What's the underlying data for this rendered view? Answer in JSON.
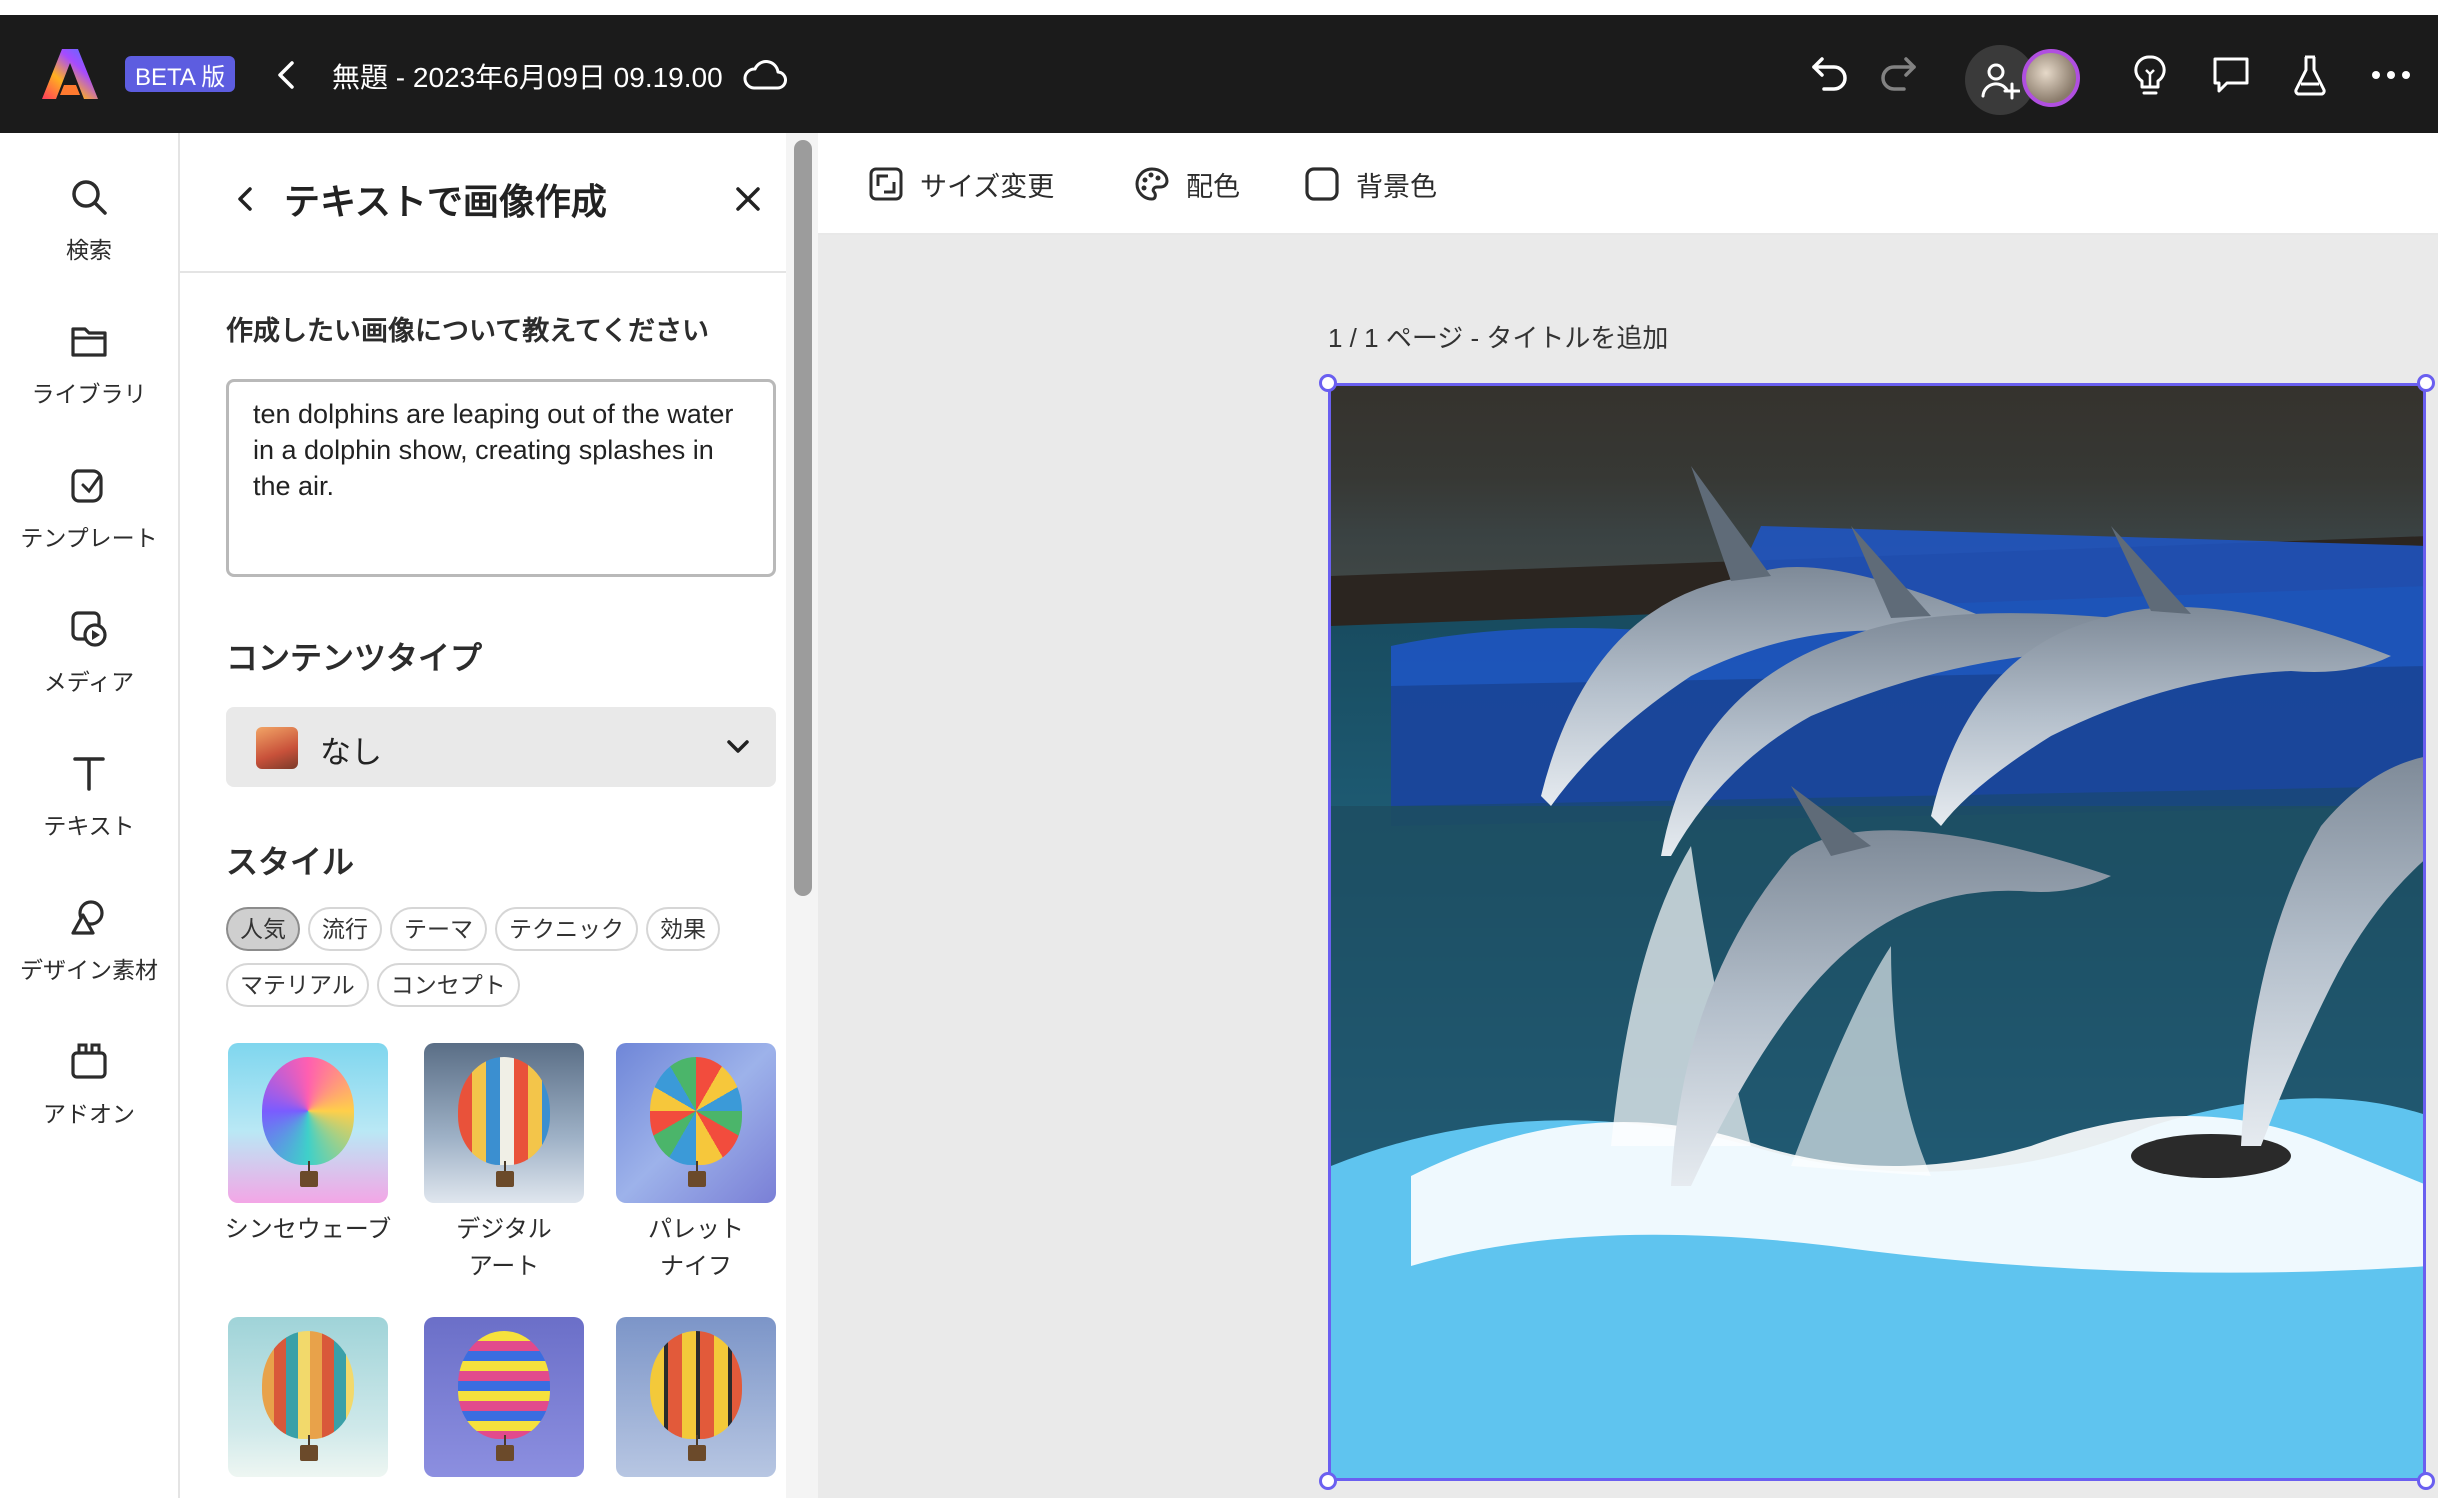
{
  "topbar": {
    "beta_label": "BETA 版",
    "doc_title": "無題 - 2023年6月09日 09.19.00"
  },
  "left_rail": {
    "items": [
      {
        "label": "検索",
        "icon": "search-icon"
      },
      {
        "label": "ライブラリ",
        "icon": "folder-icon"
      },
      {
        "label": "テンプレート",
        "icon": "template-icon"
      },
      {
        "label": "メディア",
        "icon": "media-icon"
      },
      {
        "label": "テキスト",
        "icon": "text-icon"
      },
      {
        "label": "デザイン素材",
        "icon": "shapes-icon"
      },
      {
        "label": "アドオン",
        "icon": "addon-icon"
      }
    ]
  },
  "panel": {
    "title": "テキストで画像作成",
    "prompt_label": "作成したい画像について教えてください",
    "prompt_value": "ten dolphins are leaping out of the water in a dolphin show, creating splashes in the air.",
    "content_type_label": "コンテンツタイプ",
    "content_type_value": "なし",
    "style_label": "スタイル",
    "style_chips": [
      "人気",
      "流行",
      "テーマ",
      "テクニック",
      "効果",
      "マテリアル",
      "コンセプト"
    ],
    "active_chip": "人気",
    "styles": [
      {
        "label_line1": "シンセウェーブ",
        "label_line2": ""
      },
      {
        "label_line1": "デジタル",
        "label_line2": "アート"
      },
      {
        "label_line1": "パレット",
        "label_line2": "ナイフ"
      }
    ]
  },
  "toolbar": {
    "resize_label": "サイズ変更",
    "color_label": "配色",
    "bg_label": "背景色"
  },
  "canvas": {
    "page_label": "1 / 1 ページ - タイトルを追加"
  },
  "colors": {
    "topbar_bg": "#1b1b1b",
    "beta_badge": "#5d5de0",
    "selection": "#6a5ff0",
    "avatar_ring": "#b04fe0",
    "canvas_bg": "#eaeaea"
  }
}
